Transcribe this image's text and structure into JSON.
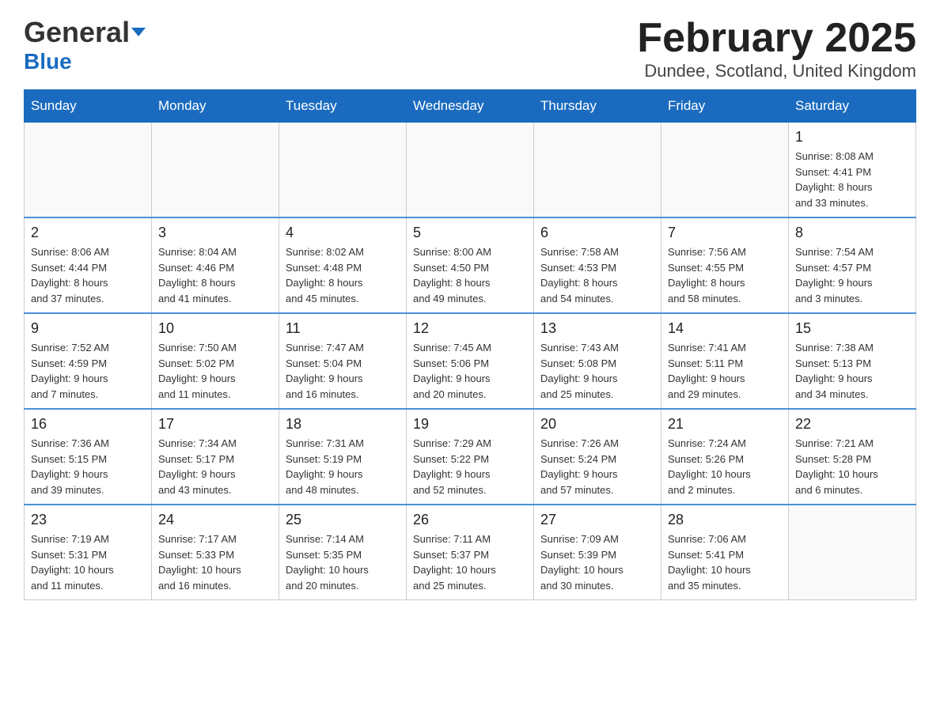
{
  "header": {
    "logo": {
      "general": "General",
      "blue": "Blue"
    },
    "title": "February 2025",
    "location": "Dundee, Scotland, United Kingdom"
  },
  "calendar": {
    "days_of_week": [
      "Sunday",
      "Monday",
      "Tuesday",
      "Wednesday",
      "Thursday",
      "Friday",
      "Saturday"
    ],
    "weeks": [
      [
        {
          "day": "",
          "info": ""
        },
        {
          "day": "",
          "info": ""
        },
        {
          "day": "",
          "info": ""
        },
        {
          "day": "",
          "info": ""
        },
        {
          "day": "",
          "info": ""
        },
        {
          "day": "",
          "info": ""
        },
        {
          "day": "1",
          "info": "Sunrise: 8:08 AM\nSunset: 4:41 PM\nDaylight: 8 hours\nand 33 minutes."
        }
      ],
      [
        {
          "day": "2",
          "info": "Sunrise: 8:06 AM\nSunset: 4:44 PM\nDaylight: 8 hours\nand 37 minutes."
        },
        {
          "day": "3",
          "info": "Sunrise: 8:04 AM\nSunset: 4:46 PM\nDaylight: 8 hours\nand 41 minutes."
        },
        {
          "day": "4",
          "info": "Sunrise: 8:02 AM\nSunset: 4:48 PM\nDaylight: 8 hours\nand 45 minutes."
        },
        {
          "day": "5",
          "info": "Sunrise: 8:00 AM\nSunset: 4:50 PM\nDaylight: 8 hours\nand 49 minutes."
        },
        {
          "day": "6",
          "info": "Sunrise: 7:58 AM\nSunset: 4:53 PM\nDaylight: 8 hours\nand 54 minutes."
        },
        {
          "day": "7",
          "info": "Sunrise: 7:56 AM\nSunset: 4:55 PM\nDaylight: 8 hours\nand 58 minutes."
        },
        {
          "day": "8",
          "info": "Sunrise: 7:54 AM\nSunset: 4:57 PM\nDaylight: 9 hours\nand 3 minutes."
        }
      ],
      [
        {
          "day": "9",
          "info": "Sunrise: 7:52 AM\nSunset: 4:59 PM\nDaylight: 9 hours\nand 7 minutes."
        },
        {
          "day": "10",
          "info": "Sunrise: 7:50 AM\nSunset: 5:02 PM\nDaylight: 9 hours\nand 11 minutes."
        },
        {
          "day": "11",
          "info": "Sunrise: 7:47 AM\nSunset: 5:04 PM\nDaylight: 9 hours\nand 16 minutes."
        },
        {
          "day": "12",
          "info": "Sunrise: 7:45 AM\nSunset: 5:06 PM\nDaylight: 9 hours\nand 20 minutes."
        },
        {
          "day": "13",
          "info": "Sunrise: 7:43 AM\nSunset: 5:08 PM\nDaylight: 9 hours\nand 25 minutes."
        },
        {
          "day": "14",
          "info": "Sunrise: 7:41 AM\nSunset: 5:11 PM\nDaylight: 9 hours\nand 29 minutes."
        },
        {
          "day": "15",
          "info": "Sunrise: 7:38 AM\nSunset: 5:13 PM\nDaylight: 9 hours\nand 34 minutes."
        }
      ],
      [
        {
          "day": "16",
          "info": "Sunrise: 7:36 AM\nSunset: 5:15 PM\nDaylight: 9 hours\nand 39 minutes."
        },
        {
          "day": "17",
          "info": "Sunrise: 7:34 AM\nSunset: 5:17 PM\nDaylight: 9 hours\nand 43 minutes."
        },
        {
          "day": "18",
          "info": "Sunrise: 7:31 AM\nSunset: 5:19 PM\nDaylight: 9 hours\nand 48 minutes."
        },
        {
          "day": "19",
          "info": "Sunrise: 7:29 AM\nSunset: 5:22 PM\nDaylight: 9 hours\nand 52 minutes."
        },
        {
          "day": "20",
          "info": "Sunrise: 7:26 AM\nSunset: 5:24 PM\nDaylight: 9 hours\nand 57 minutes."
        },
        {
          "day": "21",
          "info": "Sunrise: 7:24 AM\nSunset: 5:26 PM\nDaylight: 10 hours\nand 2 minutes."
        },
        {
          "day": "22",
          "info": "Sunrise: 7:21 AM\nSunset: 5:28 PM\nDaylight: 10 hours\nand 6 minutes."
        }
      ],
      [
        {
          "day": "23",
          "info": "Sunrise: 7:19 AM\nSunset: 5:31 PM\nDaylight: 10 hours\nand 11 minutes."
        },
        {
          "day": "24",
          "info": "Sunrise: 7:17 AM\nSunset: 5:33 PM\nDaylight: 10 hours\nand 16 minutes."
        },
        {
          "day": "25",
          "info": "Sunrise: 7:14 AM\nSunset: 5:35 PM\nDaylight: 10 hours\nand 20 minutes."
        },
        {
          "day": "26",
          "info": "Sunrise: 7:11 AM\nSunset: 5:37 PM\nDaylight: 10 hours\nand 25 minutes."
        },
        {
          "day": "27",
          "info": "Sunrise: 7:09 AM\nSunset: 5:39 PM\nDaylight: 10 hours\nand 30 minutes."
        },
        {
          "day": "28",
          "info": "Sunrise: 7:06 AM\nSunset: 5:41 PM\nDaylight: 10 hours\nand 35 minutes."
        },
        {
          "day": "",
          "info": ""
        }
      ]
    ]
  }
}
